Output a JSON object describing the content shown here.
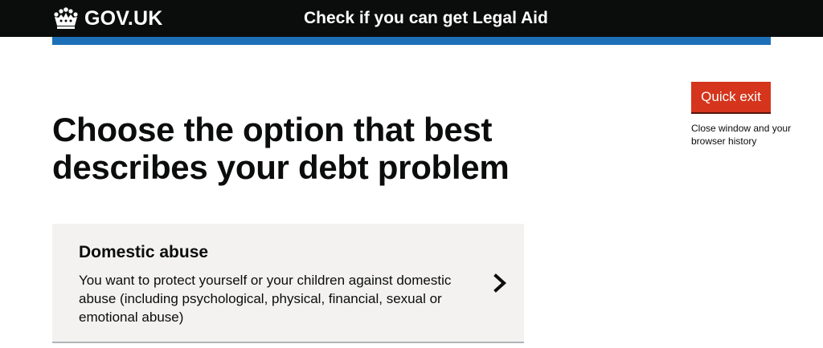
{
  "header": {
    "logo_text": "GOV.UK",
    "service_name": "Check if you can get Legal Aid"
  },
  "quick_exit": {
    "button_label": "Quick exit",
    "hint": "Close window and your browser history"
  },
  "main": {
    "title": "Choose the option that best describes your debt problem",
    "options": [
      {
        "title": "Domestic abuse",
        "description": "You want to protect yourself or your children against domestic abuse (including psychological, physical, financial, sexual or emotional abuse)"
      }
    ]
  },
  "icons": {
    "logo": "crown-icon",
    "option_arrow": "chevron-right-icon"
  },
  "colors": {
    "header_bg": "#0b0c0c",
    "accent_bar": "#1d70b8",
    "quick_exit_bg": "#d4351c",
    "card_bg": "#f3f2f1"
  }
}
